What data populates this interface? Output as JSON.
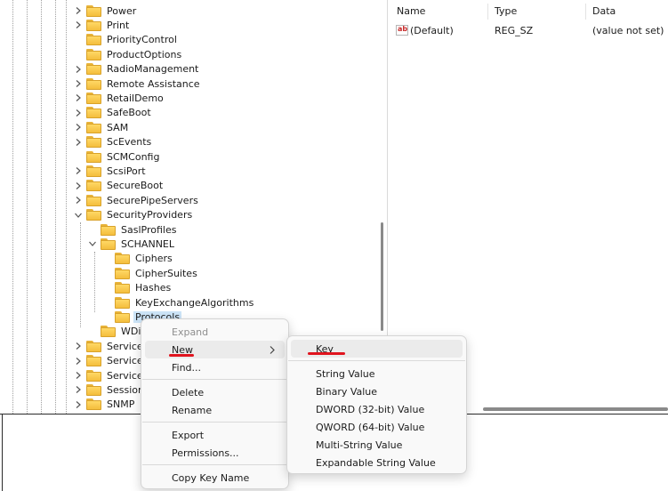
{
  "tree": {
    "items": [
      {
        "label": "Power",
        "expander": "collapsed",
        "level": 0
      },
      {
        "label": "Print",
        "expander": "collapsed",
        "level": 0
      },
      {
        "label": "PriorityControl",
        "expander": "none",
        "level": 0
      },
      {
        "label": "ProductOptions",
        "expander": "none",
        "level": 0
      },
      {
        "label": "RadioManagement",
        "expander": "collapsed",
        "level": 0
      },
      {
        "label": "Remote Assistance",
        "expander": "collapsed",
        "level": 0
      },
      {
        "label": "RetailDemo",
        "expander": "collapsed",
        "level": 0
      },
      {
        "label": "SafeBoot",
        "expander": "collapsed",
        "level": 0
      },
      {
        "label": "SAM",
        "expander": "collapsed",
        "level": 0
      },
      {
        "label": "ScEvents",
        "expander": "collapsed",
        "level": 0
      },
      {
        "label": "SCMConfig",
        "expander": "none",
        "level": 0
      },
      {
        "label": "ScsiPort",
        "expander": "collapsed",
        "level": 0
      },
      {
        "label": "SecureBoot",
        "expander": "collapsed",
        "level": 0
      },
      {
        "label": "SecurePipeServers",
        "expander": "collapsed",
        "level": 0
      },
      {
        "label": "SecurityProviders",
        "expander": "expanded",
        "level": 0
      },
      {
        "label": "SaslProfiles",
        "expander": "none",
        "level": 1
      },
      {
        "label": "SCHANNEL",
        "expander": "expanded",
        "level": 1
      },
      {
        "label": "Ciphers",
        "expander": "none",
        "level": 2
      },
      {
        "label": "CipherSuites",
        "expander": "none",
        "level": 2
      },
      {
        "label": "Hashes",
        "expander": "none",
        "level": 2
      },
      {
        "label": "KeyExchangeAlgorithms",
        "expander": "none",
        "level": 2
      },
      {
        "label": "Protocols",
        "expander": "none",
        "level": 2,
        "selected": true
      },
      {
        "label": "WDigest",
        "expander": "none",
        "level": 1
      },
      {
        "label": "ServiceAggregatedEvents",
        "expander": "collapsed",
        "level": 0
      },
      {
        "label": "ServiceGroupOrder",
        "expander": "collapsed",
        "level": 0
      },
      {
        "label": "ServiceProvider",
        "expander": "collapsed",
        "level": 0
      },
      {
        "label": "Session Manager",
        "expander": "collapsed",
        "level": 0
      },
      {
        "label": "SNMP",
        "expander": "collapsed",
        "level": 0
      }
    ]
  },
  "list": {
    "headers": {
      "name": "Name",
      "type": "Type",
      "data": "Data"
    },
    "rows": [
      {
        "icon": "string-value-icon",
        "icon_text": "ab",
        "name": "(Default)",
        "type": "REG_SZ",
        "data": "(value not set)"
      }
    ]
  },
  "context_menu": {
    "expand": "Expand",
    "new": "New",
    "find": "Find...",
    "delete": "Delete",
    "rename": "Rename",
    "export": "Export",
    "permissions": "Permissions...",
    "copy_key_name": "Copy Key Name"
  },
  "sub_menu": {
    "key": "Key",
    "string_value": "String Value",
    "binary_value": "Binary Value",
    "dword_value": "DWORD (32-bit) Value",
    "qword_value": "QWORD (64-bit) Value",
    "multi_string_value": "Multi-String Value",
    "expandable_string_value": "Expandable String Value"
  },
  "colors": {
    "folder": "#f4be3d",
    "selection": "#cce4f7",
    "menu_bg": "#f9f9f9",
    "annotation_underline": "#e0141e"
  }
}
